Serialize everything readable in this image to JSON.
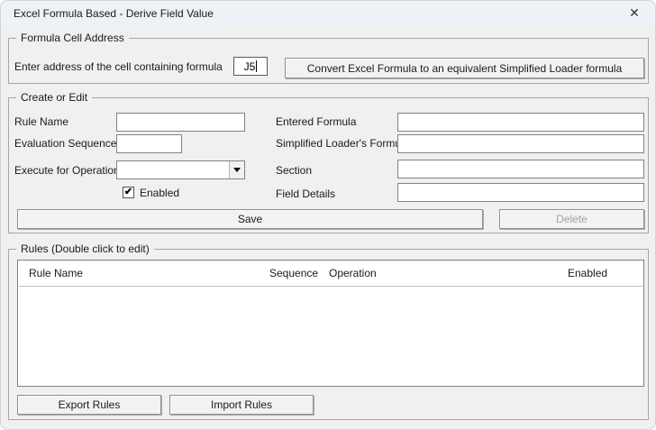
{
  "window": {
    "title": "Excel Formula Based - Derive Field Value"
  },
  "icons": {
    "close": "✕",
    "check": "✔"
  },
  "formula_cell_address": {
    "legend": "Formula Cell Address",
    "cell_label": "Enter address of the cell containing formula",
    "cell_value": "J5",
    "convert_button": "Convert Excel Formula to an equivalent Simplified Loader formula"
  },
  "create_or_edit": {
    "legend": "Create or Edit",
    "rule_name_label": "Rule Name",
    "rule_name_value": "",
    "evaluation_sequence_label": "Evaluation Sequence",
    "evaluation_sequence_value": "",
    "execute_for_operation_label": "Execute for Operation",
    "execute_for_operation_value": "",
    "enabled_label": "Enabled",
    "enabled_checked": true,
    "entered_formula_label": "Entered Formula",
    "entered_formula_value": "",
    "simplified_loader_formula_label": "Simplified Loader's Formula",
    "simplified_loader_formula_value": "",
    "section_label": "Section",
    "section_value": "",
    "field_details_label": "Field Details",
    "field_details_value": "",
    "save_button": "Save",
    "delete_button": "Delete"
  },
  "rules": {
    "legend": "Rules (Double click to edit)",
    "columns": [
      "Rule Name",
      "Sequence",
      "Operation",
      "Enabled"
    ],
    "rows": [],
    "export_button": "Export Rules",
    "import_button": "Import Rules"
  }
}
